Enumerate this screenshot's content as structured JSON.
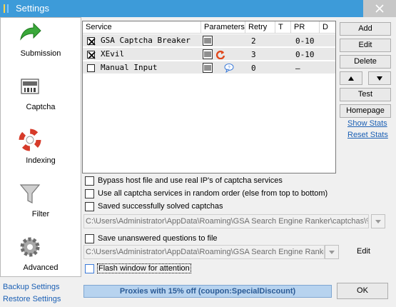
{
  "window": {
    "title": "Settings"
  },
  "sidebar": {
    "items": [
      {
        "label": "Submission",
        "icon": "green-arrow-icon"
      },
      {
        "label": "Captcha",
        "icon": "captcha-icon"
      },
      {
        "label": "Indexing",
        "icon": "lifebuoy-icon"
      },
      {
        "label": "Filter",
        "icon": "funnel-icon"
      },
      {
        "label": "Advanced",
        "icon": "gear-icon"
      }
    ],
    "links": [
      "Backup Settings",
      "Restore Settings"
    ]
  },
  "grid": {
    "columns": [
      "Service",
      "Parameters",
      "Retry",
      "T",
      "PR",
      "D"
    ],
    "rows": [
      {
        "checked": true,
        "service": "GSA Captcha Breaker",
        "retry": "2",
        "pr": "0-10"
      },
      {
        "checked": true,
        "service": "XEvil",
        "retry": "3",
        "pr": "0-10"
      },
      {
        "checked": false,
        "service": "Manual Input",
        "retry": "0",
        "pr": "–"
      }
    ]
  },
  "buttons": {
    "add": "Add",
    "edit": "Edit",
    "delete": "Delete",
    "up": "▲",
    "down": "▼",
    "test": "Test",
    "homepage": "Homepage",
    "show_stats": "Show Stats",
    "reset_stats": "Reset Stats",
    "ok": "OK",
    "edit2": "Edit"
  },
  "options": {
    "bypass_host": "Bypass host file and use real IP's of captcha services",
    "random_order": "Use all captcha services in random order (else from top to bottom)",
    "save_solved": "Saved successfully solved captchas",
    "save_unanswered": "Save unanswered questions to file",
    "flash_window": "Flash window for attention"
  },
  "paths": {
    "solved": "C:\\Users\\Administrator\\AppData\\Roaming\\GSA Search Engine Ranker\\captchas\\%",
    "unanswered": "C:\\Users\\Administrator\\AppData\\Roaming\\GSA Search Engine Ranker\\"
  },
  "banner": "Proxies with 15% off  (coupon:SpecialDiscount)",
  "colors": {
    "titlebar": "#3d9bd9",
    "link": "#1a5fb4",
    "banner_bg": "#b7d3ef",
    "banner_text": "#2b5b96"
  }
}
